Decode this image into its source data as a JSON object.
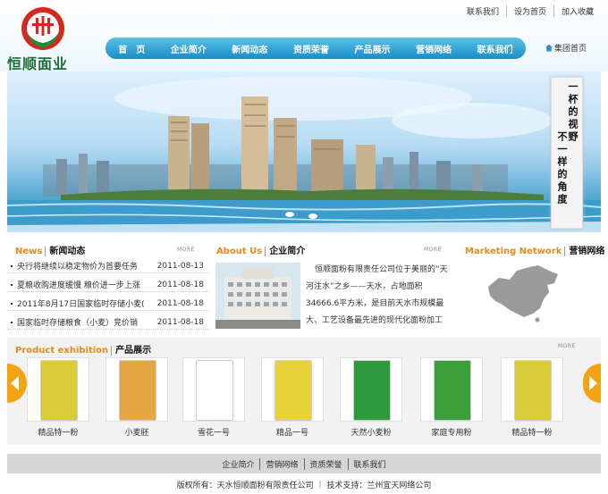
{
  "header": {
    "site_name": "恒顺面业",
    "top_links": [
      "联系我们",
      "设为首页",
      "加入收藏"
    ],
    "group_home": "集团首页"
  },
  "nav": [
    "首　页",
    "企业简介",
    "新闻动态",
    "资质荣誉",
    "产品展示",
    "营销网络",
    "联系我们"
  ],
  "banner": {
    "slogan_right": "一杯的视野",
    "slogan_left": "不一样的角度"
  },
  "news": {
    "title_en": "News",
    "title_cn": "新闻动态",
    "more": "MORE",
    "items": [
      {
        "title": "央行将继续以稳定物价为首要任务",
        "date": "2011-08-13"
      },
      {
        "title": "夏粮收购进度缓慢 粮价进一步上涨",
        "date": "2011-08-18"
      },
      {
        "title": "2011年8月17日国家临时存储小麦(",
        "date": "2011-08-18"
      },
      {
        "title": "国家临时存储粮食（小麦）竞价销",
        "date": "2011-08-18"
      }
    ]
  },
  "company": {
    "title_en": "About Us",
    "title_cn": "企业简介",
    "more": "MORE",
    "text": "恒顺面粉有限责任公司位于美丽的“天河注水”之乡——天水，占地面积34666.6平方米，是目前天水市规模最大、工艺设备最先进的现代化面粉加工企业，公司拥有新..."
  },
  "network": {
    "title_en": "Marketing Network",
    "title_cn": "营销网络"
  },
  "products": {
    "title_en": "Product exhibition",
    "title_cn": "产品展示",
    "more": "MORE",
    "items": [
      {
        "name": "精品特一粉",
        "color": "#d9cc3a"
      },
      {
        "name": "小麦胚",
        "color": "#e3a642"
      },
      {
        "name": "雪花一号",
        "color": "#ffffff"
      },
      {
        "name": "精品一号",
        "color": "#e8d23b"
      },
      {
        "name": "天然小麦粉",
        "color": "#2f9a3c"
      },
      {
        "name": "家庭专用粉",
        "color": "#3c9e3a"
      },
      {
        "name": "精品特一粉",
        "color": "#d9cc3a"
      }
    ]
  },
  "footer": {
    "links": [
      "企业简介",
      "营销网络",
      "资质荣誉",
      "联系我们"
    ],
    "copyright": "版权所有：天水恒顺面粉有限责任公司 ｜ 技术支持：兰州宜天网络公司"
  }
}
